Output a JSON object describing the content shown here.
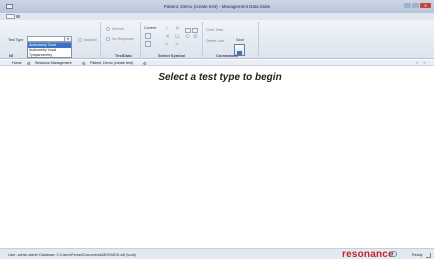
{
  "window": {
    "title": "Patient, Demo (create test) - Management Data Suite",
    "close_glyph": "✕"
  },
  "ribbon": {
    "test_type_label": "Test Type",
    "dropdown_options": [
      "Audiometry Tonal",
      "Audiometry Vocal",
      "Tympanometry"
    ],
    "dropdown_selected_index": 0,
    "masked_label": "Masked",
    "normal_label": "Normal",
    "no_response_label": "No Response",
    "testdata_group_label": "TestData",
    "ni_label": "NI",
    "current_label": "Current",
    "select_symbol_label": "Select Symbol",
    "clear_data_label": "Clear Data",
    "delete_last_label": "Delete Last",
    "save_label": "Save",
    "commands_label": "Commands"
  },
  "tabs": [
    {
      "label": "Home"
    },
    {
      "label": "Sessions Management"
    },
    {
      "label": "Patient, Demo (create test)"
    }
  ],
  "main": {
    "message": "Select a test type to begin"
  },
  "status": {
    "text": "User: admin admin   Database: C:\\Users\\Ferrari\\Documents\\MDS\\MDS.sdf (local)",
    "brand": "resonance",
    "ready": "Ready"
  }
}
